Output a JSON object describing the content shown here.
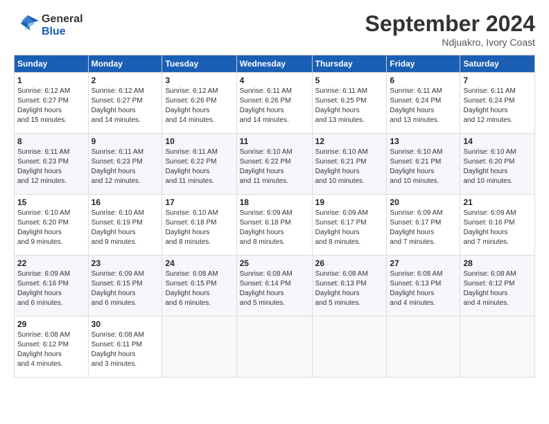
{
  "header": {
    "logo_general": "General",
    "logo_blue": "Blue",
    "month_title": "September 2024",
    "location": "Ndjuakro, Ivory Coast"
  },
  "days_of_week": [
    "Sunday",
    "Monday",
    "Tuesday",
    "Wednesday",
    "Thursday",
    "Friday",
    "Saturday"
  ],
  "weeks": [
    [
      {
        "day": "1",
        "sunrise": "6:12 AM",
        "sunset": "6:27 PM",
        "daylight": "12 hours and 15 minutes."
      },
      {
        "day": "2",
        "sunrise": "6:12 AM",
        "sunset": "6:27 PM",
        "daylight": "12 hours and 14 minutes."
      },
      {
        "day": "3",
        "sunrise": "6:12 AM",
        "sunset": "6:26 PM",
        "daylight": "12 hours and 14 minutes."
      },
      {
        "day": "4",
        "sunrise": "6:11 AM",
        "sunset": "6:26 PM",
        "daylight": "12 hours and 14 minutes."
      },
      {
        "day": "5",
        "sunrise": "6:11 AM",
        "sunset": "6:25 PM",
        "daylight": "12 hours and 13 minutes."
      },
      {
        "day": "6",
        "sunrise": "6:11 AM",
        "sunset": "6:24 PM",
        "daylight": "12 hours and 13 minutes."
      },
      {
        "day": "7",
        "sunrise": "6:11 AM",
        "sunset": "6:24 PM",
        "daylight": "12 hours and 12 minutes."
      }
    ],
    [
      {
        "day": "8",
        "sunrise": "6:11 AM",
        "sunset": "6:23 PM",
        "daylight": "12 hours and 12 minutes."
      },
      {
        "day": "9",
        "sunrise": "6:11 AM",
        "sunset": "6:23 PM",
        "daylight": "12 hours and 12 minutes."
      },
      {
        "day": "10",
        "sunrise": "6:11 AM",
        "sunset": "6:22 PM",
        "daylight": "12 hours and 11 minutes."
      },
      {
        "day": "11",
        "sunrise": "6:10 AM",
        "sunset": "6:22 PM",
        "daylight": "12 hours and 11 minutes."
      },
      {
        "day": "12",
        "sunrise": "6:10 AM",
        "sunset": "6:21 PM",
        "daylight": "12 hours and 10 minutes."
      },
      {
        "day": "13",
        "sunrise": "6:10 AM",
        "sunset": "6:21 PM",
        "daylight": "12 hours and 10 minutes."
      },
      {
        "day": "14",
        "sunrise": "6:10 AM",
        "sunset": "6:20 PM",
        "daylight": "12 hours and 10 minutes."
      }
    ],
    [
      {
        "day": "15",
        "sunrise": "6:10 AM",
        "sunset": "6:20 PM",
        "daylight": "12 hours and 9 minutes."
      },
      {
        "day": "16",
        "sunrise": "6:10 AM",
        "sunset": "6:19 PM",
        "daylight": "12 hours and 9 minutes."
      },
      {
        "day": "17",
        "sunrise": "6:10 AM",
        "sunset": "6:18 PM",
        "daylight": "12 hours and 8 minutes."
      },
      {
        "day": "18",
        "sunrise": "6:09 AM",
        "sunset": "6:18 PM",
        "daylight": "12 hours and 8 minutes."
      },
      {
        "day": "19",
        "sunrise": "6:09 AM",
        "sunset": "6:17 PM",
        "daylight": "12 hours and 8 minutes."
      },
      {
        "day": "20",
        "sunrise": "6:09 AM",
        "sunset": "6:17 PM",
        "daylight": "12 hours and 7 minutes."
      },
      {
        "day": "21",
        "sunrise": "6:09 AM",
        "sunset": "6:16 PM",
        "daylight": "12 hours and 7 minutes."
      }
    ],
    [
      {
        "day": "22",
        "sunrise": "6:09 AM",
        "sunset": "6:16 PM",
        "daylight": "12 hours and 6 minutes."
      },
      {
        "day": "23",
        "sunrise": "6:09 AM",
        "sunset": "6:15 PM",
        "daylight": "12 hours and 6 minutes."
      },
      {
        "day": "24",
        "sunrise": "6:08 AM",
        "sunset": "6:15 PM",
        "daylight": "12 hours and 6 minutes."
      },
      {
        "day": "25",
        "sunrise": "6:08 AM",
        "sunset": "6:14 PM",
        "daylight": "12 hours and 5 minutes."
      },
      {
        "day": "26",
        "sunrise": "6:08 AM",
        "sunset": "6:13 PM",
        "daylight": "12 hours and 5 minutes."
      },
      {
        "day": "27",
        "sunrise": "6:08 AM",
        "sunset": "6:13 PM",
        "daylight": "12 hours and 4 minutes."
      },
      {
        "day": "28",
        "sunrise": "6:08 AM",
        "sunset": "6:12 PM",
        "daylight": "12 hours and 4 minutes."
      }
    ],
    [
      {
        "day": "29",
        "sunrise": "6:08 AM",
        "sunset": "6:12 PM",
        "daylight": "12 hours and 4 minutes."
      },
      {
        "day": "30",
        "sunrise": "6:08 AM",
        "sunset": "6:11 PM",
        "daylight": "12 hours and 3 minutes."
      },
      null,
      null,
      null,
      null,
      null
    ]
  ],
  "labels": {
    "sunrise": "Sunrise:",
    "sunset": "Sunset:",
    "daylight": "Daylight hours"
  }
}
